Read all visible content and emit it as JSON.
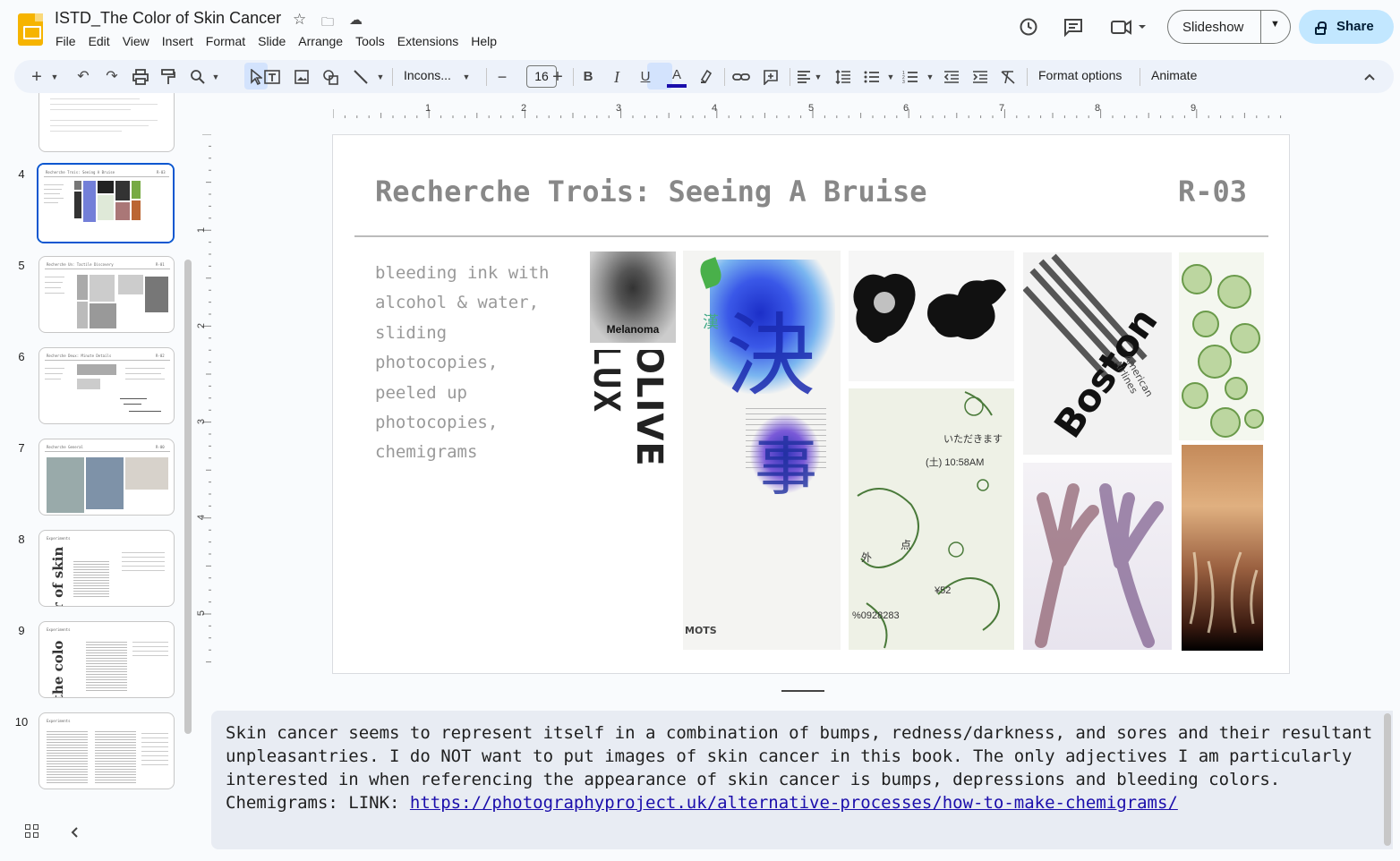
{
  "header": {
    "doc_title": "ISTD_The Color of Skin Cancer",
    "menu": [
      "File",
      "Edit",
      "View",
      "Insert",
      "Format",
      "Slide",
      "Arrange",
      "Tools",
      "Extensions",
      "Help"
    ],
    "slideshow_label": "Slideshow",
    "share_label": "Share"
  },
  "toolbar": {
    "font_name": "Incons...",
    "font_size": "16",
    "format_options": "Format options",
    "animate": "Animate"
  },
  "filmstrip": {
    "thumbs": [
      {
        "num": "",
        "title": ""
      },
      {
        "num": "4",
        "title": "Recherche Trois: Seeing A Bruise"
      },
      {
        "num": "5",
        "title": "Recherche Un: Tactile Discovery"
      },
      {
        "num": "6",
        "title": "Recherche Deux: Minute Details"
      },
      {
        "num": "7",
        "title": "Recherche General"
      },
      {
        "num": "8",
        "title": "Experiments"
      },
      {
        "num": "9",
        "title": "Experiments"
      },
      {
        "num": "10",
        "title": "Experiments"
      }
    ],
    "thumb_rnums": [
      "R-03",
      "R-01",
      "R-02",
      "R-00"
    ],
    "thumb8_vertical": "r of skin",
    "thumb9_vertical": "the colo"
  },
  "rulers": {
    "top": [
      "1",
      "2",
      "3",
      "4",
      "5",
      "6",
      "7",
      "8",
      "9"
    ],
    "left": [
      "1",
      "2",
      "3",
      "4",
      "5"
    ]
  },
  "slide": {
    "title": "Recherche Trois: Seeing A Bruise",
    "number": "R-03",
    "body_lines": [
      "bleeding ink with",
      "alcohol & water,",
      "sliding",
      "photocopies,",
      "peeled up",
      "photocopies,",
      "chemigrams"
    ],
    "images": {
      "melanoma_label": "Melanoma",
      "lux_text": "LUX",
      "olive_text": "OLIVE",
      "kanji_small": "漢",
      "kanji_big_1": "決",
      "kanji_big_2": "事",
      "mots_label": "MOTS",
      "receipt_1": "いただきます",
      "receipt_2": "(土) 10:58AM",
      "receipt_3": "%0928283",
      "receipt_4": "¥52",
      "receipt_5": "点",
      "receipt_6": "外",
      "boston_text": "Boston",
      "airline_text": "American Airlines"
    }
  },
  "notes": {
    "text": "Skin cancer seems to represent itself in a combination of bumps, redness/darkness, and sores and their resultant unpleasantries. I do NOT want to put images of skin cancer in this book. The only adjectives I am particularly interested in when referencing the appearance of skin cancer is bumps, depressions and bleeding colors.",
    "link_prefix": "Chemigrams: LINK: ",
    "link": "https://photographyproject.uk/alternative-processes/how-to-make-chemigrams/"
  },
  "colors": {
    "accent": "#0b57d0",
    "share_bg": "#c2e7ff",
    "toolbar_bg": "#edf2fa",
    "notes_bg": "#e8ecf3",
    "text_color_bar": "#1a0dab"
  }
}
